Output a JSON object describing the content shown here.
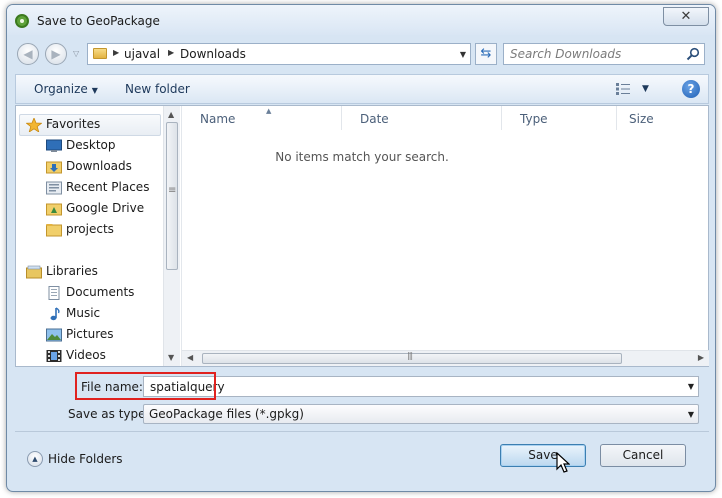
{
  "window": {
    "title": "Save to GeoPackage",
    "close_label": "✕"
  },
  "address_bar": {
    "crumbs": [
      "ujaval",
      "Downloads"
    ]
  },
  "search": {
    "placeholder": "Search Downloads"
  },
  "toolbar": {
    "organize_label": "Organize",
    "new_folder_label": "New folder",
    "help_label": "?"
  },
  "nav_pane": {
    "items": [
      {
        "label": "Favorites",
        "icon": "star-icon",
        "level": 0
      },
      {
        "label": "Desktop",
        "icon": "desktop-icon",
        "level": 1
      },
      {
        "label": "Downloads",
        "icon": "downloads-folder-icon",
        "level": 1
      },
      {
        "label": "Recent Places",
        "icon": "recent-places-icon",
        "level": 1
      },
      {
        "label": "Google Drive",
        "icon": "google-drive-folder-icon",
        "level": 1
      },
      {
        "label": "projects",
        "icon": "folder-icon",
        "level": 1
      },
      {
        "label": "Libraries",
        "icon": "libraries-icon",
        "level": 0
      },
      {
        "label": "Documents",
        "icon": "documents-icon",
        "level": 1
      },
      {
        "label": "Music",
        "icon": "music-icon",
        "level": 1
      },
      {
        "label": "Pictures",
        "icon": "pictures-icon",
        "level": 1
      },
      {
        "label": "Videos",
        "icon": "videos-icon",
        "level": 1
      }
    ]
  },
  "file_list": {
    "columns": [
      "Name",
      "Date",
      "Type",
      "Size"
    ],
    "empty_message": "No items match your search."
  },
  "fields": {
    "filename_label": "File name:",
    "filename_value": "spatialquery",
    "savetype_label": "Save as type:",
    "savetype_value": "GeoPackage files (*.gpkg)"
  },
  "footer": {
    "hide_folders_label": "Hide Folders",
    "save_label": "Save",
    "cancel_label": "Cancel"
  },
  "colors": {
    "highlight_box": "#e0221f",
    "window_frame": "#d7e5f3",
    "link_text": "#1e395b"
  }
}
